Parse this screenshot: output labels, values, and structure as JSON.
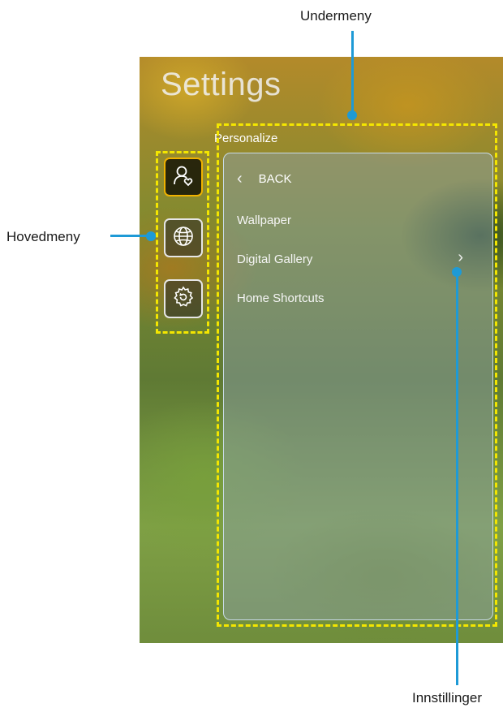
{
  "callouts": {
    "top": "Undermeny",
    "left": "Hovedmeny",
    "bottom": "Innstillinger"
  },
  "screen": {
    "title": "Settings",
    "section_label": "Personalize",
    "back_label": "BACK",
    "back_icon": "chevron-left-icon",
    "menu_items": [
      "Wallpaper",
      "Digital Gallery",
      "Home Shortcuts"
    ],
    "submenu_icon": "chevron-right-icon",
    "sidebar_icons": [
      "person-heart-icon",
      "globe-icon",
      "gear-refresh-icon"
    ]
  },
  "colors": {
    "highlight_dash": "#f4e600",
    "callout_line": "#1e9ad6",
    "active_border": "#f0b200"
  }
}
